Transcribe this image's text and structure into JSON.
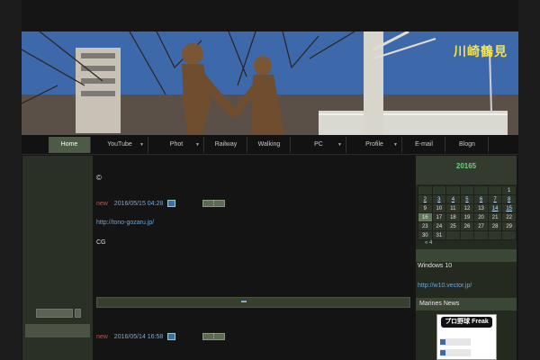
{
  "header": {
    "title": "川崎鶴見"
  },
  "nav": {
    "items": [
      {
        "label": "Home",
        "active": true,
        "dropdown": false
      },
      {
        "label": "YouTube",
        "active": false,
        "dropdown": true
      },
      {
        "label": "Phot",
        "active": false,
        "dropdown": true
      },
      {
        "label": "Railway",
        "active": false,
        "dropdown": false
      },
      {
        "label": "Walking",
        "active": false,
        "dropdown": false
      },
      {
        "label": "PC",
        "active": false,
        "dropdown": true
      },
      {
        "label": "Profile",
        "active": false,
        "dropdown": true
      },
      {
        "label": "E-mail",
        "active": false,
        "dropdown": false
      },
      {
        "label": "Blogn",
        "active": false,
        "dropdown": false
      }
    ]
  },
  "main": {
    "copyright": "©",
    "post1": {
      "new": "new",
      "date": "2016/05/15 04:28",
      "btn": "⋮",
      "link": "http://tono-gozaru.jp/",
      "text": "CG"
    },
    "post2": {
      "new": "new",
      "date": "2016/05/14 16:58",
      "btn": "⋮"
    }
  },
  "sidebar": {
    "calendar_title": "20165",
    "calendar_rows": [
      [
        "",
        "",
        "",
        "",
        "",
        "",
        "1"
      ],
      [
        "2",
        "3",
        "4",
        "5",
        "6",
        "7",
        "8"
      ],
      [
        "9",
        "10",
        "11",
        "12",
        "13",
        "14",
        "15"
      ],
      [
        "16",
        "17",
        "18",
        "19",
        "20",
        "21",
        "22"
      ],
      [
        "23",
        "24",
        "25",
        "26",
        "27",
        "28",
        "29"
      ],
      [
        "30",
        "31",
        "",
        "",
        "",
        "",
        ""
      ]
    ],
    "calendar_nav": "« 4",
    "win10_text": "Windows 10",
    "win10_link": "http://w10.vector.jp/",
    "marines_title": "Marines News",
    "widget_title": "プロ野球 Freak"
  },
  "colors": {
    "accent": "#4d5a46",
    "link": "#6aa6d8",
    "new": "#e14a3a",
    "title": "#f2e34a"
  }
}
